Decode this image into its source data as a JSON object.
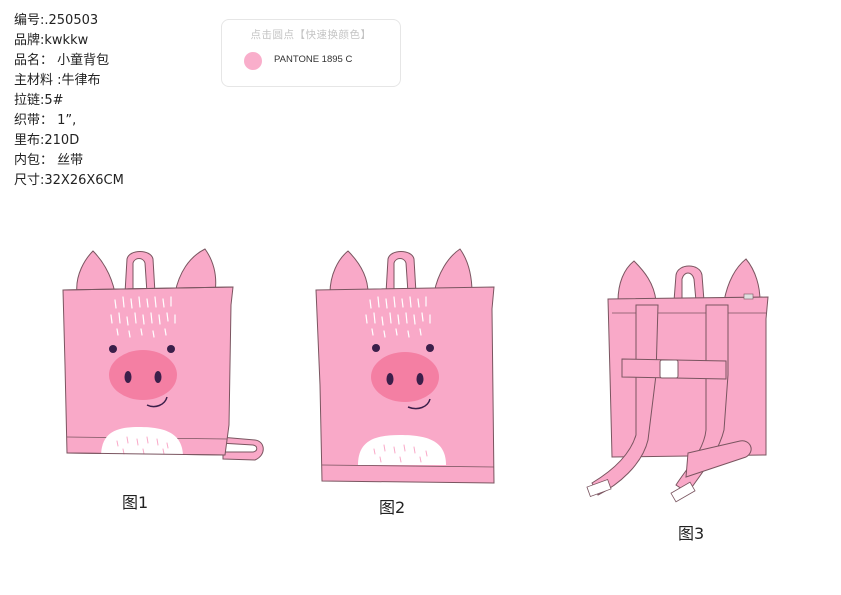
{
  "specs": {
    "code": "编号:.250503",
    "brand": "品牌:kwkkw",
    "name": "品名： 小童背包",
    "material": "主材料 :牛律布",
    "zipper": "拉链:5#",
    "webbing": "织带： 1”,",
    "lining": "里布:210D",
    "inner": "内包： 丝带",
    "size": "尺寸:32X26X6CM"
  },
  "color_panel": {
    "title": "点击圆点【快速换颜色】",
    "swatch_label": "PANTONE 1895 C",
    "swatch_color": "#f9aecb"
  },
  "figures": {
    "fig1_caption": "图1",
    "fig2_caption": "图2",
    "fig3_caption": "图3"
  },
  "colors": {
    "body": "#f9a9c8",
    "outline": "#7a5560",
    "snout": "#f47fa3",
    "belly": "#ffffff"
  }
}
